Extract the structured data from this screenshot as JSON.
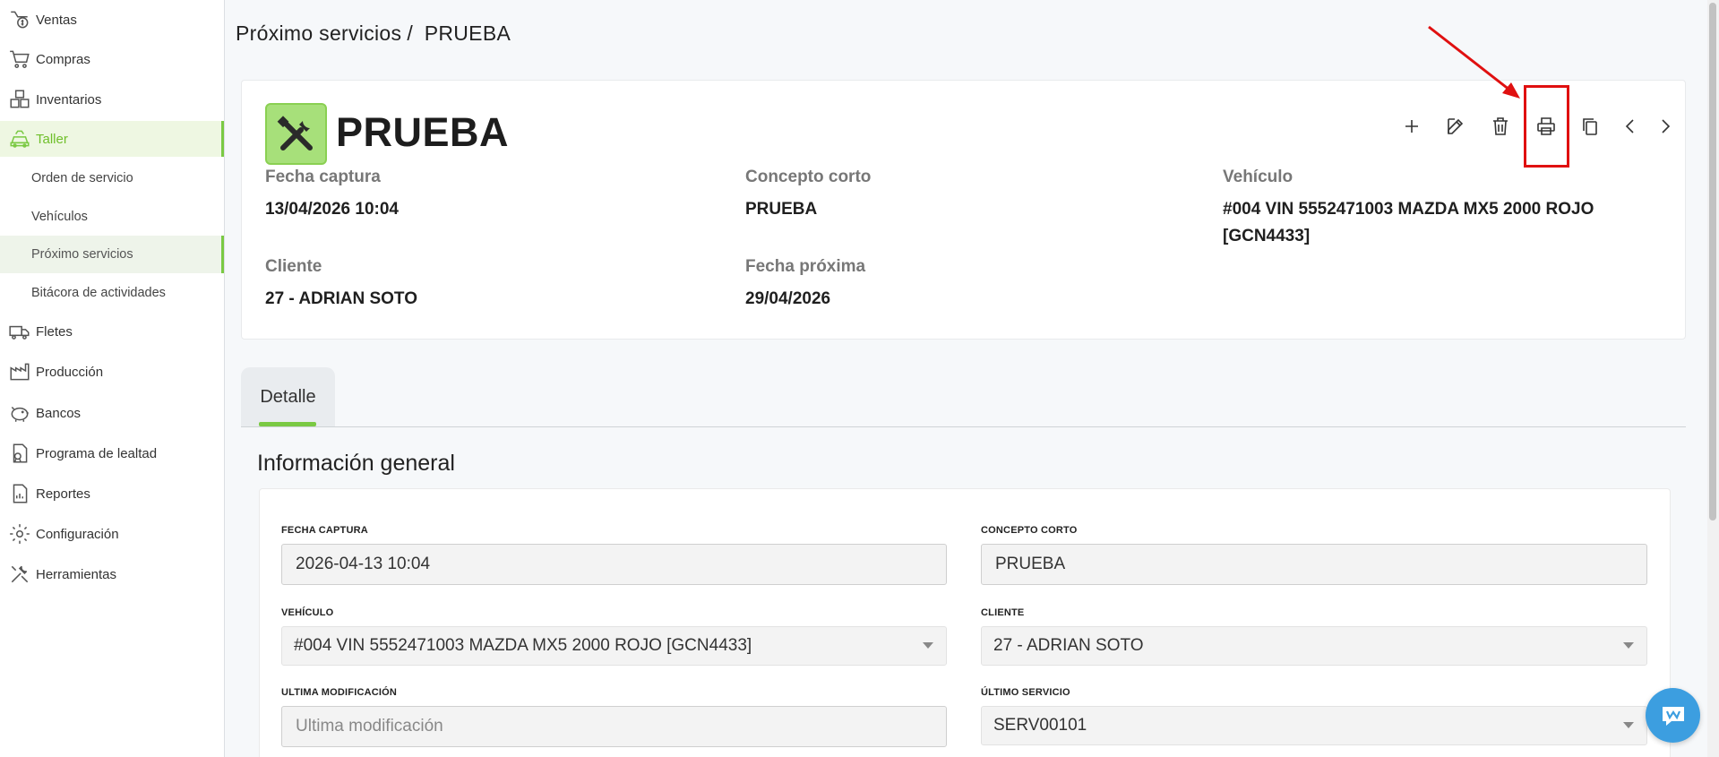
{
  "sidebar": {
    "items": [
      {
        "label": "Ventas",
        "icon": "sales-icon"
      },
      {
        "label": "Compras",
        "icon": "cart-icon"
      },
      {
        "label": "Inventarios",
        "icon": "boxes-icon"
      },
      {
        "label": "Taller",
        "icon": "car-workshop-icon"
      },
      {
        "label": "Fletes",
        "icon": "truck-icon"
      },
      {
        "label": "Producción",
        "icon": "factory-icon"
      },
      {
        "label": "Bancos",
        "icon": "piggy-bank-icon"
      },
      {
        "label": "Programa de lealtad",
        "icon": "loyalty-icon"
      },
      {
        "label": "Reportes",
        "icon": "report-icon"
      },
      {
        "label": "Configuración",
        "icon": "gear-icon"
      },
      {
        "label": "Herramientas",
        "icon": "tools-icon"
      }
    ],
    "subitems": [
      {
        "label": "Orden de servicio"
      },
      {
        "label": "Vehículos"
      },
      {
        "label": "Próximo servicios"
      },
      {
        "label": "Bitácora de actividades"
      }
    ],
    "active_item": "Taller",
    "active_subitem": "Próximo servicios",
    "accent_color": "#7ac943"
  },
  "breadcrumb": {
    "parent": "Próximo servicios",
    "separator": "/",
    "current": "PRUEBA"
  },
  "record": {
    "title": "PRUEBA",
    "fields": {
      "fecha_captura": {
        "label": "Fecha captura",
        "value": "13/04/2026 10:04"
      },
      "concepto_corto": {
        "label": "Concepto corto",
        "value": "PRUEBA"
      },
      "vehiculo": {
        "label": "Vehículo",
        "value": "#004 VIN 5552471003 MAZDA MX5 2000 ROJO [GCN4433]"
      },
      "cliente": {
        "label": "Cliente",
        "value": "27 - ADRIAN SOTO"
      },
      "fecha_proxima": {
        "label": "Fecha próxima",
        "value": "29/04/2026"
      }
    }
  },
  "toolbar": {
    "buttons": [
      "add-icon",
      "edit-icon",
      "delete-icon",
      "print-icon",
      "copy-icon",
      "chevron-left-icon",
      "chevron-right-icon"
    ],
    "highlighted": "print-icon",
    "highlight_color": "#e01010"
  },
  "tabs": [
    {
      "label": "Detalle"
    }
  ],
  "section": {
    "title": "Información general"
  },
  "form": {
    "fecha_captura": {
      "label": "FECHA CAPTURA",
      "value": "2026-04-13 10:04"
    },
    "concepto_corto": {
      "label": "CONCEPTO CORTO",
      "value": "PRUEBA"
    },
    "vehiculo": {
      "label": "VEHÍCULO",
      "value": "#004 VIN 5552471003 MAZDA MX5 2000 ROJO [GCN4433]"
    },
    "cliente": {
      "label": "CLIENTE",
      "value": "27 - ADRIAN SOTO"
    },
    "ultima_modificacion": {
      "label": "ULTIMA MODIFICACIÓN",
      "placeholder": "Ultima modificación"
    },
    "ultimo_servicio": {
      "label": "ÚLTIMO SERVICIO",
      "value": "SERV00101"
    }
  }
}
